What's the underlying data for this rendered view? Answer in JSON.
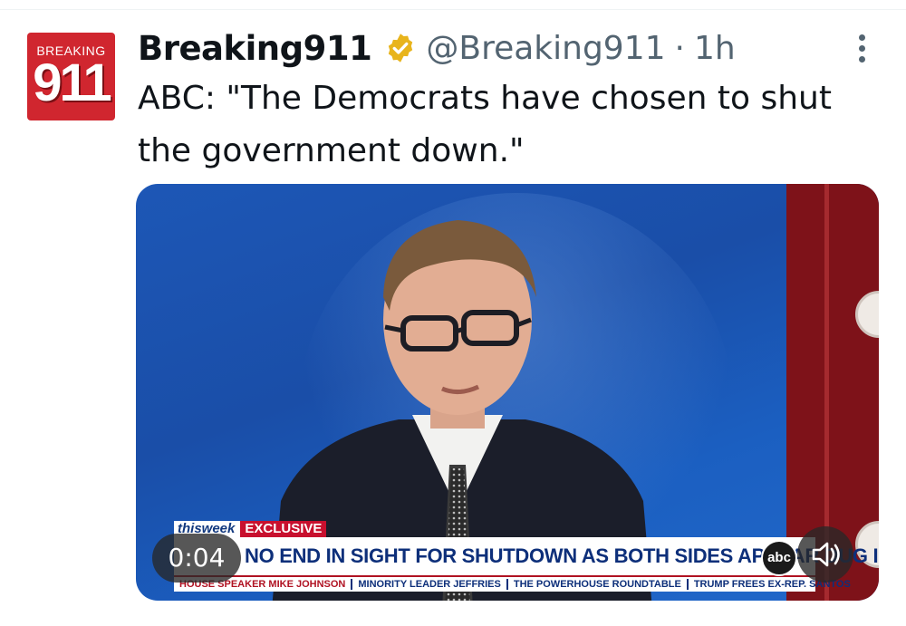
{
  "author": {
    "avatar_top": "BREAKING",
    "avatar_number": "911",
    "display_name": "Breaking911",
    "handle": "@Breaking911",
    "separator": "·",
    "time": "1h",
    "verified_color": "#e8b41c"
  },
  "tweet": {
    "text": "ABC: \"The Democrats have chosen to shut the government down.\""
  },
  "video": {
    "elapsed": "0:04",
    "show_name": "thisweek",
    "tag": "EXCLUSIVE",
    "headline": "NO END IN SIGHT FOR SHUTDOWN AS BOTH SIDES APPEAR DUG IN",
    "ticker": [
      "HOUSE SPEAKER MIKE JOHNSON",
      "MINORITY LEADER JEFFRIES",
      "THE POWERHOUSE ROUNDTABLE",
      "TRUMP FREES EX-REP. SANTOS"
    ],
    "network_logo": "abc",
    "mute_icon": "speaker-icon"
  },
  "colors": {
    "accent_text": "#0f1419",
    "secondary_text": "#536471",
    "abc_blue": "#0d2f7a",
    "abc_red": "#c8102e"
  }
}
